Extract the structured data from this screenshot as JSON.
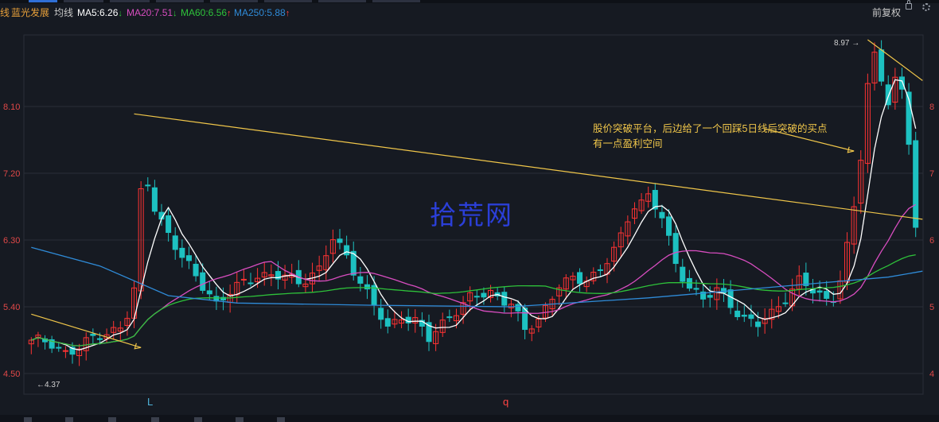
{
  "header": {
    "left_fragment": "线",
    "stock_name": "蓝光发展",
    "indicator_label": "均线",
    "ma5": {
      "label": "MA5:6.26",
      "arrow": "↓",
      "color": "#ffffff"
    },
    "ma20": {
      "label": "MA20:7.51",
      "arrow": "↓",
      "color": "#d84dc0"
    },
    "ma60": {
      "label": "MA60:6.56",
      "arrow": "↑",
      "color": "#2ec23a"
    },
    "ma250": {
      "label": "MA250:5.88",
      "arrow": "↑",
      "color": "#2f8bd8"
    },
    "adjust_label": "前复权"
  },
  "annotation": {
    "line1": "股价突破平台，后边给了一个回踩5日线后突破的买点",
    "line2": "有一点盈利空间"
  },
  "watermark": "拾荒网",
  "chart_data": {
    "type": "candlestick",
    "y_axis_left": [
      {
        "value": 8.1,
        "label": "8.10"
      },
      {
        "value": 7.2,
        "label": "7.20"
      },
      {
        "value": 6.3,
        "label": "6.30"
      },
      {
        "value": 5.4,
        "label": "5.40"
      },
      {
        "value": 4.5,
        "label": "4.50"
      }
    ],
    "y_axis_right": [
      {
        "value": 8.1,
        "label": "8"
      },
      {
        "value": 7.2,
        "label": "7"
      },
      {
        "value": 6.3,
        "label": "6"
      },
      {
        "value": 5.4,
        "label": "5"
      },
      {
        "value": 4.5,
        "label": "4"
      }
    ],
    "ylim": [
      4.37,
      9.05
    ],
    "price_labels": [
      {
        "text": "8.97",
        "kind": "high"
      },
      {
        "text": "4.37",
        "kind": "low"
      }
    ],
    "x_markers": [
      {
        "text": "L",
        "index": 18
      },
      {
        "text": "q",
        "index": 72
      }
    ],
    "num_bars": 130,
    "key_points": [
      [
        0,
        4.95
      ],
      [
        3,
        4.88
      ],
      [
        5,
        4.8
      ],
      [
        8,
        4.9
      ],
      [
        10,
        5.0
      ],
      [
        12,
        5.1
      ],
      [
        13,
        5.15
      ],
      [
        14,
        5.3
      ],
      [
        15,
        5.6
      ],
      [
        16,
        6.9
      ],
      [
        17,
        7.05
      ],
      [
        18,
        6.75
      ],
      [
        20,
        6.4
      ],
      [
        22,
        6.05
      ],
      [
        24,
        5.8
      ],
      [
        26,
        5.6
      ],
      [
        27,
        5.45
      ],
      [
        30,
        5.65
      ],
      [
        33,
        5.85
      ],
      [
        36,
        5.8
      ],
      [
        39,
        5.75
      ],
      [
        42,
        5.9
      ],
      [
        44,
        6.3
      ],
      [
        46,
        6.1
      ],
      [
        48,
        5.75
      ],
      [
        50,
        5.4
      ],
      [
        52,
        5.1
      ],
      [
        54,
        5.3
      ],
      [
        56,
        5.2
      ],
      [
        58,
        4.95
      ],
      [
        61,
        5.3
      ],
      [
        64,
        5.5
      ],
      [
        67,
        5.6
      ],
      [
        70,
        5.45
      ],
      [
        72,
        5.05
      ],
      [
        74,
        5.25
      ],
      [
        77,
        5.7
      ],
      [
        80,
        5.75
      ],
      [
        83,
        5.9
      ],
      [
        86,
        6.3
      ],
      [
        88,
        6.8
      ],
      [
        90,
        6.9
      ],
      [
        92,
        6.6
      ],
      [
        94,
        5.95
      ],
      [
        96,
        5.7
      ],
      [
        98,
        5.5
      ],
      [
        100,
        5.6
      ],
      [
        102,
        5.45
      ],
      [
        104,
        5.25
      ],
      [
        106,
        5.15
      ],
      [
        108,
        5.3
      ],
      [
        110,
        5.55
      ],
      [
        112,
        5.75
      ],
      [
        114,
        5.6
      ],
      [
        116,
        5.5
      ],
      [
        117,
        5.55
      ],
      [
        118,
        5.8
      ],
      [
        119,
        6.2
      ],
      [
        120,
        6.7
      ],
      [
        121,
        7.4
      ],
      [
        122,
        8.4
      ],
      [
        123,
        8.8
      ],
      [
        124,
        8.5
      ],
      [
        125,
        8.2
      ],
      [
        126,
        8.45
      ],
      [
        127,
        8.25
      ],
      [
        128,
        7.6
      ],
      [
        129,
        6.5
      ],
      [
        130,
        6.0
      ]
    ],
    "ma_series": [
      {
        "name": "MA5",
        "period": 5,
        "color": "#ffffff"
      },
      {
        "name": "MA20",
        "period": 20,
        "color": "#d84dc0"
      },
      {
        "name": "MA60",
        "period": 60,
        "color": "#2ec23a"
      },
      {
        "name": "MA250",
        "period": 250,
        "color": "#2f8bd8"
      }
    ],
    "ma250_points": [
      [
        0,
        6.2
      ],
      [
        10,
        5.95
      ],
      [
        20,
        5.55
      ],
      [
        30,
        5.45
      ],
      [
        50,
        5.42
      ],
      [
        70,
        5.4
      ],
      [
        90,
        5.52
      ],
      [
        110,
        5.68
      ],
      [
        125,
        5.8
      ],
      [
        130,
        5.88
      ]
    ],
    "trend_lines": [
      {
        "from": [
          0,
          5.3
        ],
        "to": [
          16,
          4.85
        ],
        "arrow": true
      },
      {
        "from": [
          15,
          8.0
        ],
        "to": [
          130,
          6.58
        ],
        "arrow": false
      },
      {
        "from": [
          122,
          9.0
        ],
        "to": [
          130,
          8.45
        ],
        "arrow": false
      },
      {
        "from": [
          107,
          7.8
        ],
        "to": [
          120,
          7.5
        ],
        "arrow": true
      }
    ],
    "colors": {
      "up": "#ff3333",
      "down": "#1dc1c1",
      "trend": "#f0c64a",
      "grid": "#2a2e38"
    }
  }
}
